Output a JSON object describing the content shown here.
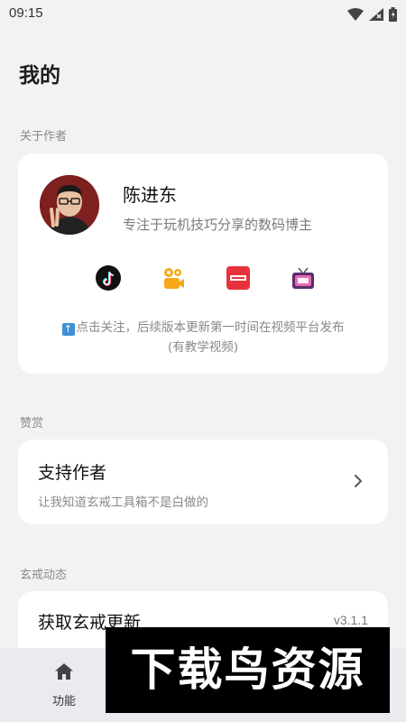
{
  "status_bar": {
    "time": "09:15"
  },
  "page": {
    "title": "我的"
  },
  "about": {
    "section_label": "关于作者",
    "name": "陈进东",
    "bio": "专注于玩机技巧分享的数码博主",
    "socials": [
      {
        "icon": "tiktok-icon"
      },
      {
        "icon": "kuaishou-icon"
      },
      {
        "icon": "xiaohongshu-icon",
        "text": "小红书"
      },
      {
        "icon": "tv-icon"
      }
    ],
    "notice_line1": "点击关注，后续版本更新第一时间在视频平台发布",
    "notice_line2": "(有教学视频)"
  },
  "reward": {
    "section_label": "赞赏",
    "title": "支持作者",
    "subtitle": "让我知道玄戒工具箱不是白做的"
  },
  "news": {
    "section_label": "玄戒动态",
    "title": "获取玄戒更新",
    "version": "v3.1.1"
  },
  "bottom_nav": {
    "items": [
      {
        "label": "功能",
        "icon": "home-icon"
      }
    ]
  },
  "watermark": {
    "text": "下载鸟资源"
  },
  "colors": {
    "background": "#f2f2f5",
    "card": "#ffffff",
    "muted": "#8a8a8a"
  }
}
